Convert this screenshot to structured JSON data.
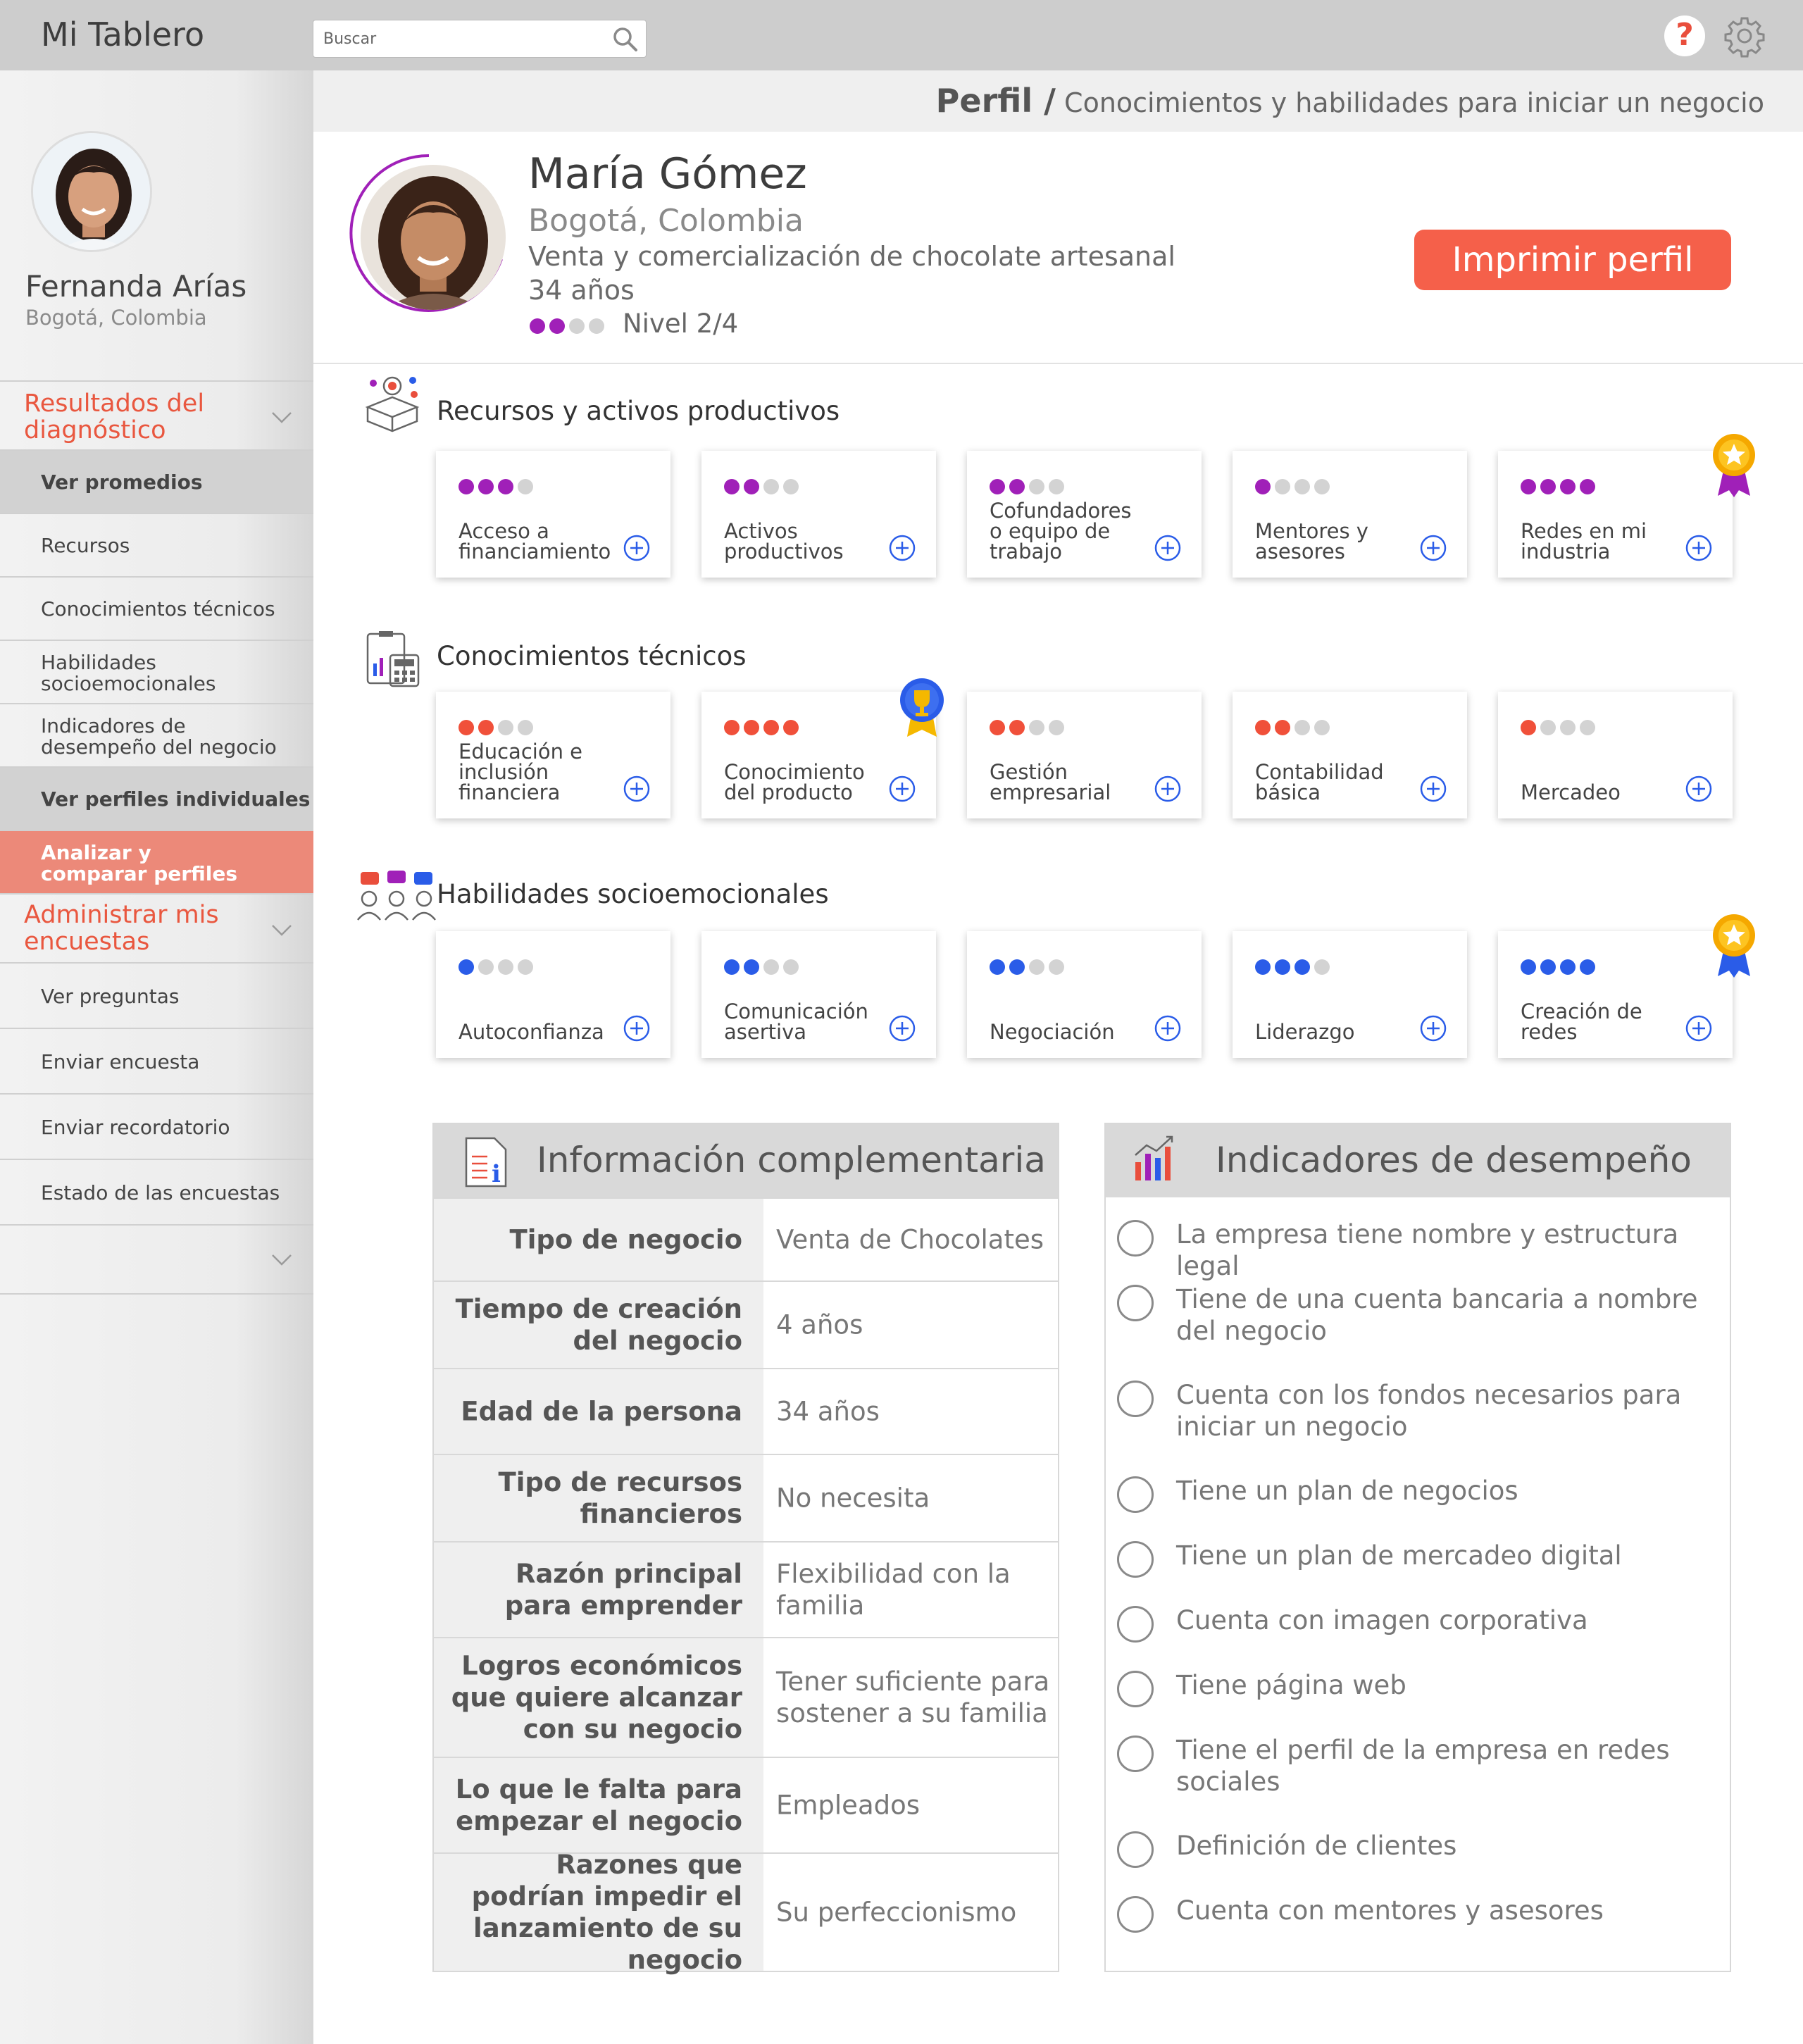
{
  "header": {
    "app_title": "Mi Tablero",
    "search_placeholder": "Buscar"
  },
  "sidebar": {
    "user_name": "Fernanda Arías",
    "user_location": "Bogotá, Colombia",
    "section1_title": "Resultados del diagnóstico",
    "items1": [
      "Ver promedios",
      "Recursos",
      "Conocimientos técnicos",
      "Habilidades socioemocionales",
      "Indicadores de desempeño del negocio",
      "Ver perfiles individuales",
      "Analizar y comparar perfiles"
    ],
    "section2_title": "Administrar mis encuestas",
    "items2": [
      "Ver preguntas",
      "Enviar encuesta",
      "Enviar recordatorio",
      "Estado de las encuestas"
    ]
  },
  "breadcrumb": {
    "root": "Perfil /",
    "current": "Conocimientos y habilidades para iniciar un negocio"
  },
  "profile": {
    "name": "María Gómez",
    "location": "Bogotá, Colombia",
    "business": "Venta y comercialización de chocolate artesanal",
    "age": "34 años",
    "level_label": "Nivel 2/4",
    "level_value": 2,
    "level_max": 4,
    "print_button": "Imprimir perfil"
  },
  "colors": {
    "accent": "#f5604a",
    "sidebar_section": "#e9573f",
    "recursos": "#a020b8",
    "conocimientos": "#f0503a",
    "habilidades": "#2a5ce8",
    "empty_dot": "#d3d3d3"
  },
  "sections": [
    {
      "title": "Recursos y activos productivos",
      "icon": "box-brain-icon",
      "color": "#a020b8",
      "cards": [
        {
          "label": "Acceso a financiamiento",
          "level": 3
        },
        {
          "label": "Activos productivos",
          "level": 2
        },
        {
          "label": "Cofundadores o equipo de trabajo",
          "level": 2
        },
        {
          "label": "Mentores y asesores",
          "level": 1
        },
        {
          "label": "Redes en mi industria",
          "level": 4,
          "medal": "gold-medal-icon"
        }
      ]
    },
    {
      "title": "Conocimientos técnicos",
      "icon": "calculator-clipboard-icon",
      "color": "#f0503a",
      "cards": [
        {
          "label": "Educación e inclusión financiera",
          "level": 2
        },
        {
          "label": "Conocimiento del producto",
          "level": 4,
          "medal": "trophy-badge-icon"
        },
        {
          "label": "Gestión empresarial",
          "level": 2
        },
        {
          "label": "Contabilidad básica",
          "level": 2
        },
        {
          "label": "Mercadeo",
          "level": 1
        }
      ]
    },
    {
      "title": "Habilidades socioemocionales",
      "icon": "people-chat-icon",
      "color": "#2a5ce8",
      "cards": [
        {
          "label": "Autoconfianza",
          "level": 1
        },
        {
          "label": "Comunicación asertiva",
          "level": 2
        },
        {
          "label": "Negociación",
          "level": 2
        },
        {
          "label": "Liderazgo",
          "level": 3
        },
        {
          "label": "Creación de redes",
          "level": 4,
          "medal": "blue-medal-icon"
        }
      ]
    }
  ],
  "info_panel": {
    "title": "Información complementaria",
    "rows": [
      {
        "key": "Tipo de negocio",
        "value": "Venta de Chocolates"
      },
      {
        "key": "Tiempo de creación del negocio",
        "value": "4 años"
      },
      {
        "key": "Edad de la persona",
        "value": "34 años"
      },
      {
        "key": "Tipo de recursos financieros",
        "value": "No necesita"
      },
      {
        "key": "Razón principal para emprender",
        "value": "Flexibilidad con la familia"
      },
      {
        "key": "Logros económicos que quiere alcanzar con su negocio",
        "value": "Tener suficiente para sostener a su familia"
      },
      {
        "key": "Lo que le falta para empezar el negocio",
        "value": "Empleados"
      },
      {
        "key": "Razones que podrían impedir el lanzamiento de su negocio",
        "value": "Su perfeccionismo"
      }
    ]
  },
  "indicators_panel": {
    "title": "Indicadores de desempeño",
    "items": [
      "La empresa tiene nombre y estructura legal",
      "Tiene de una cuenta bancaria a nombre del negocio",
      "Cuenta con los fondos necesarios para iniciar un negocio",
      "Tiene un plan de negocios",
      "Tiene un plan de mercadeo digital",
      "Cuenta con imagen corporativa",
      "Tiene página web",
      "Tiene el perfil de la empresa en redes sociales",
      "Definición de clientes",
      "Cuenta con mentores y asesores"
    ]
  }
}
